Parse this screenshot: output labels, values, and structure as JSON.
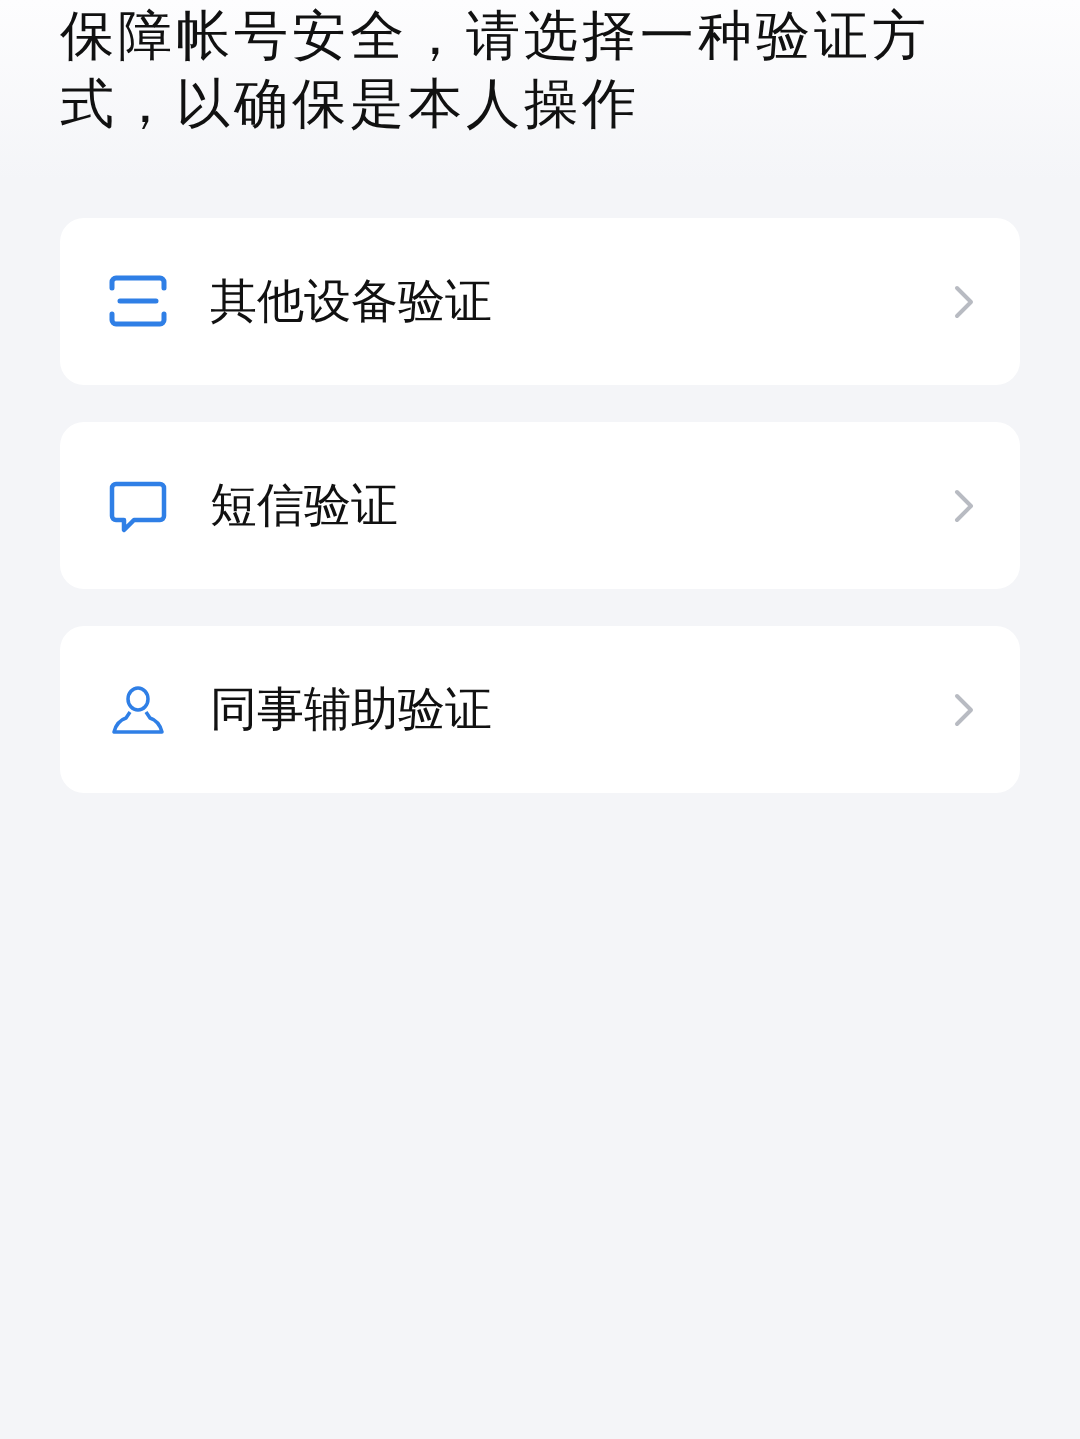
{
  "heading_lines": [
    "保障帐号安全，请选择一种验证方",
    "式，以确保是本人操作"
  ],
  "options": [
    {
      "kind": "device",
      "label": "其他设备验证"
    },
    {
      "kind": "sms",
      "label": "短信验证"
    },
    {
      "kind": "colleague",
      "label": "同事辅助验证"
    }
  ]
}
